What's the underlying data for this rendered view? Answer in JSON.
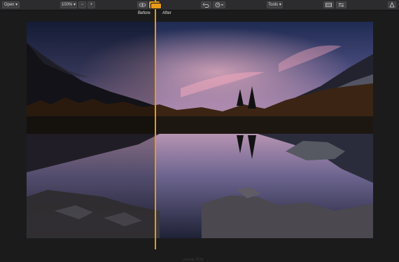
{
  "toolbar": {
    "open_label": "Open",
    "zoom_value": "100%",
    "zoom_out_label": "−",
    "zoom_in_label": "+",
    "tools_label": "Tools"
  },
  "compare": {
    "before_label": "Before",
    "after_label": "After"
  },
  "footer": {
    "watermark": "Luminar 2018"
  },
  "colors": {
    "accent": "#e59a1a",
    "toolbar_bg": "#2c2c2e",
    "canvas_bg": "#1b1b1c"
  },
  "icons": [
    "eye-icon",
    "compare-icon",
    "undo-icon",
    "history-icon",
    "chevron-down-icon",
    "panels-icon",
    "sliders-icon",
    "share-icon"
  ]
}
